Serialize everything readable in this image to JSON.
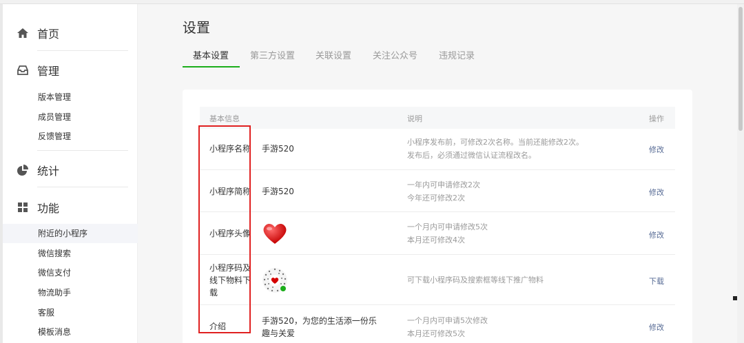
{
  "sidebar": {
    "groups": [
      {
        "label": "首页",
        "icon": "home-icon"
      },
      {
        "label": "管理",
        "icon": "inbox-icon"
      },
      {
        "label": "统计",
        "icon": "pie-chart-icon"
      },
      {
        "label": "功能",
        "icon": "grid-icon"
      }
    ],
    "manage_items": [
      "版本管理",
      "成员管理",
      "反馈管理"
    ],
    "feature_items": [
      "附近的小程序",
      "微信搜索",
      "微信支付",
      "物流助手",
      "客服",
      "模板消息"
    ]
  },
  "page": {
    "title": "设置",
    "tabs": [
      "基本设置",
      "第三方设置",
      "关联设置",
      "关注公众号",
      "违规记录"
    ],
    "active_tab": "基本设置"
  },
  "table": {
    "headers": {
      "info": "基本信息",
      "desc": "说明",
      "op": "操作"
    },
    "rows": [
      {
        "label": "小程序名称",
        "value": "手游520",
        "desc1": "小程序发布前，可修改2次名称。当前还能修改2次。",
        "desc2": "发布后，必须通过微信认证流程改名。",
        "op": "修改"
      },
      {
        "label": "小程序简称",
        "value": "手游520",
        "desc1": "一年内可申请修改2次",
        "desc2": "今年还可修改2次",
        "op": "修改"
      },
      {
        "label": "小程序头像",
        "value": "",
        "desc1": "一个月内可申请修改5次",
        "desc2": "本月还可修改4次",
        "op": "修改"
      },
      {
        "label": "小程序码及线下物料下载",
        "value": "",
        "desc1": "可下载小程序码及搜索框等线下推广物料",
        "desc2": "",
        "op": "下载"
      },
      {
        "label": "介绍",
        "value": "手游520，为您的生活添一份乐趣与关爱",
        "desc1": "一个月内可申请5次修改",
        "desc2": "本月还可修改5次",
        "op": "修改"
      }
    ]
  },
  "colors": {
    "accent": "#1aad19",
    "link": "#576b95",
    "highlight_box": "#e02020"
  }
}
